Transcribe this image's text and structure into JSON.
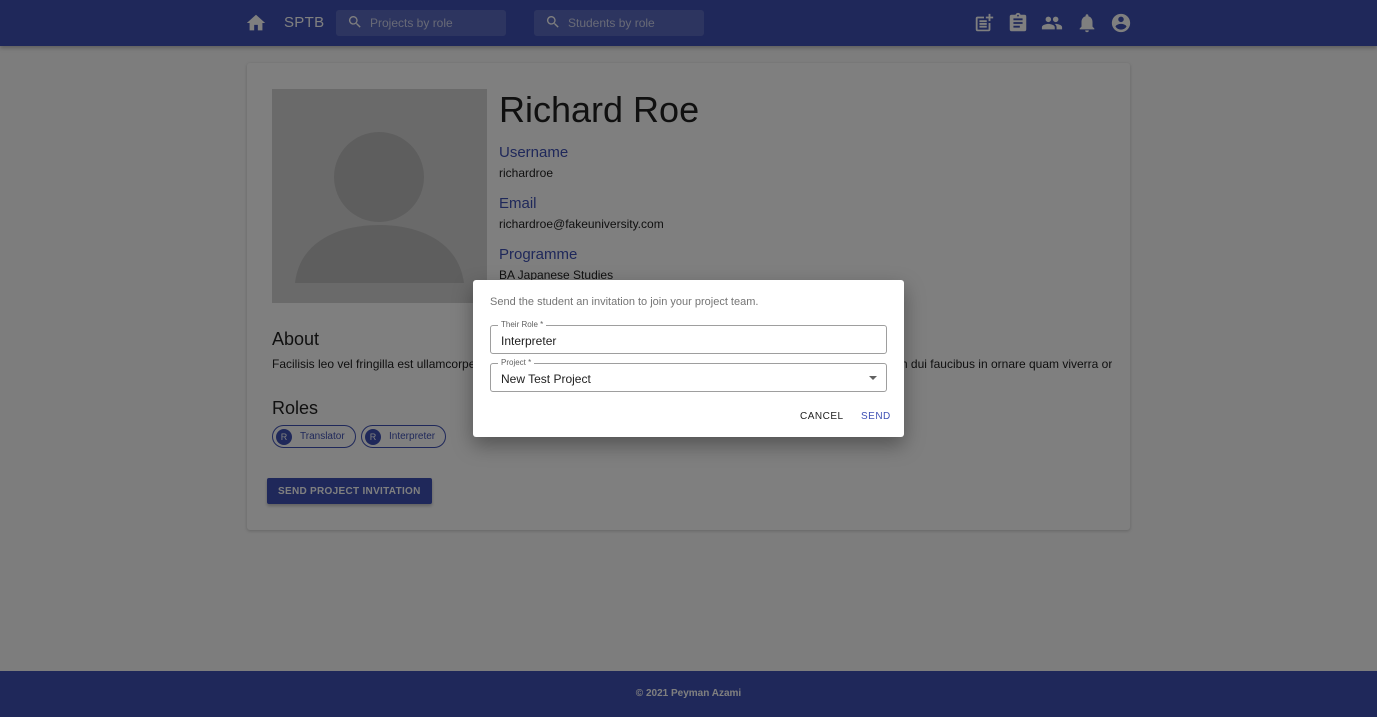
{
  "appbar": {
    "brand": "SPTB",
    "search_projects_placeholder": "Projects by role",
    "search_students_placeholder": "Students by role",
    "icons": [
      "home-icon",
      "search-icon",
      "post-add-icon",
      "assignment-icon",
      "people-icon",
      "notifications-icon",
      "account-circle-icon"
    ]
  },
  "profile": {
    "name": "Richard Roe",
    "username_label": "Username",
    "username": "richardroe",
    "email_label": "Email",
    "email": "richardroe@fakeuniversity.com",
    "programme_label": "Programme",
    "programme": "BA Japanese Studies",
    "about_title": "About",
    "about_text": "Facilisis leo vel fringilla est ullamcorper eget nulla facilisi etiam dignissim diam quis enim lobortis scelerisque fermentum dui faucibus in ornare quam viverra orci sagittis eu volutpat odio facilisis mauris sit amet massa eleifend donec.",
    "roles_title": "Roles",
    "roles": [
      {
        "avatar": "R",
        "label": "Translator"
      },
      {
        "avatar": "R",
        "label": "Interpreter"
      }
    ],
    "invite_button": "SEND PROJECT INVITATION"
  },
  "dialog": {
    "text": "Send the student an invitation to join your project team.",
    "role_label": "Their Role *",
    "role_value": "Interpreter",
    "project_label": "Project *",
    "project_value": "New Test Project",
    "cancel": "CANCEL",
    "send": "SEND"
  },
  "footer": {
    "copyright": "© 2021 Peyman Azami"
  },
  "colors": {
    "primary": "#3f51b5",
    "backdrop": "rgba(0,0,0,0.5)"
  }
}
